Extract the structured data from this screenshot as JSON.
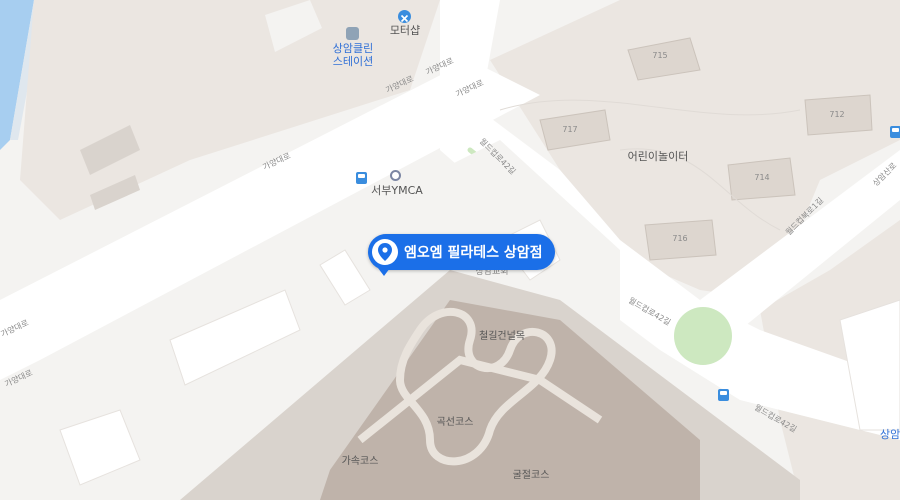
{
  "colors": {
    "background": "#f4f3f1",
    "road": "#ffffff",
    "block": "#ebe6e1",
    "building": "#d9d3cd",
    "track": "#bfb3aa",
    "park": "#cde8c0",
    "water": "#a7cef0",
    "marker": "#1b6fe8",
    "bus": "#3a8dde"
  },
  "marker": {
    "label": "엠오엠 필라테스 상암점",
    "icon": "location-pin-icon"
  },
  "pois": [
    {
      "id": "motor-shop",
      "label": "모터샵",
      "icon": "wrench-icon"
    },
    {
      "id": "clean-station",
      "label_line1": "상암클린",
      "label_line2": "스테이션",
      "icon": "station-icon"
    },
    {
      "id": "ymca",
      "label": "서부YMCA",
      "icon": "place-icon"
    },
    {
      "id": "playground",
      "label": "어린이놀이터"
    },
    {
      "id": "church",
      "label": "상암교회"
    },
    {
      "id": "iron-bridge",
      "label": "철길건널목"
    },
    {
      "id": "curve-course",
      "label": "곡선코스"
    },
    {
      "id": "accel-course",
      "label": "가속코스"
    },
    {
      "id": "bend-course",
      "label": "굴절코스"
    },
    {
      "id": "edge-label",
      "label": "상암"
    }
  ],
  "buildings": [
    "715",
    "717",
    "712",
    "714",
    "716"
  ],
  "roads": {
    "main": "가양대로",
    "side": "월드컵북로1길",
    "north_side": "월드컵로42길",
    "east": "상암산로"
  }
}
